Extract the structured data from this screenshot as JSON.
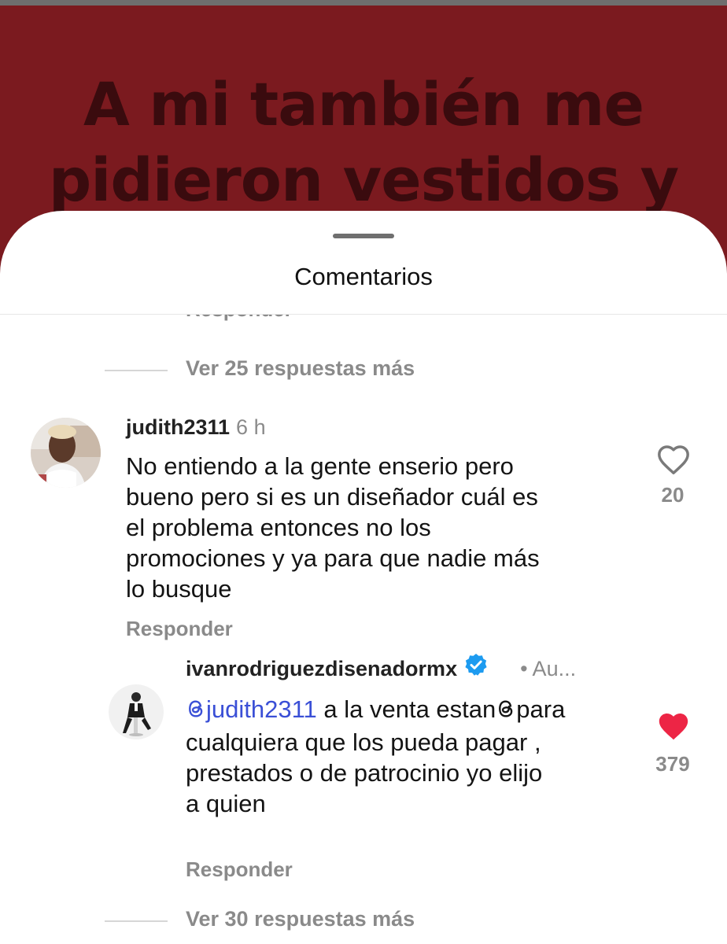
{
  "post": {
    "caption_line1": "A mi también me",
    "caption_line2": "pidieron vestidos y"
  },
  "sheet": {
    "title": "Comentarios"
  },
  "thread_top": {
    "cut_reply_label": "Responder",
    "view_more": "Ver 25 respuestas más"
  },
  "comments": [
    {
      "username": "judith2311",
      "time": "6 h",
      "text_lines": [
        "No entiendo a la gente enserio pero",
        "bueno pero si es un diseñador cuál es",
        "el problema entonces no los",
        "promociones y ya para que nadie más",
        "lo busque"
      ],
      "reply_label": "Responder",
      "likes": "20",
      "liked": false
    },
    {
      "username": "ivanrodriguezdisenadormx",
      "verified": true,
      "author_tag": "• Au...",
      "mention": "judith2311",
      "text_first_part": " a la venta estan",
      "text_after_icon": "para",
      "text_lines": [
        "cualquiera que los pueda pagar ,",
        "prestados o de patrocinio yo elijo",
        "a quien"
      ],
      "reply_label": "Responder",
      "likes": "379",
      "liked": true,
      "view_more": "Ver 30 respuestas más"
    }
  ],
  "colors": {
    "post_background": "#7b1a1f",
    "caption_text": "#3a0b0e",
    "liked_heart": "#ed2545",
    "mention": "#3a4fd6",
    "verified_badge": "#1d9bf0"
  },
  "icons": [
    "heart-outline-icon",
    "heart-filled-icon",
    "verified-badge-icon",
    "threads-icon"
  ]
}
